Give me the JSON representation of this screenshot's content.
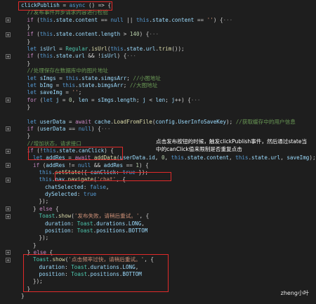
{
  "code_lines": [
    {
      "indent": 1,
      "fold": false,
      "tokens": [
        [
          "prop",
          "clickPublish"
        ],
        [
          "pl",
          " = "
        ],
        [
          "kw",
          "async"
        ],
        [
          "pl",
          " () => {"
        ]
      ]
    },
    {
      "indent": 2,
      "fold": false,
      "tokens": [
        [
          "cm",
          "//发布事件异步请求内容进行检验"
        ]
      ]
    },
    {
      "indent": 2,
      "fold": true,
      "tokens": [
        [
          "ctl",
          "if"
        ],
        [
          "pl",
          " ("
        ],
        [
          "kw",
          "this"
        ],
        [
          "pl",
          "."
        ],
        [
          "prop",
          "state"
        ],
        [
          "pl",
          "."
        ],
        [
          "prop",
          "content"
        ],
        [
          "pl",
          " == "
        ],
        [
          "kw",
          "null"
        ],
        [
          "pl",
          " || "
        ],
        [
          "kw",
          "this"
        ],
        [
          "pl",
          "."
        ],
        [
          "prop",
          "state"
        ],
        [
          "pl",
          "."
        ],
        [
          "prop",
          "content"
        ],
        [
          "pl",
          " == "
        ],
        [
          "str",
          "''"
        ],
        [
          "pl",
          ") {"
        ],
        [
          "ell",
          "···"
        ]
      ]
    },
    {
      "indent": 2,
      "fold": false,
      "tokens": [
        [
          "pl",
          "}"
        ]
      ]
    },
    {
      "indent": 2,
      "fold": true,
      "tokens": [
        [
          "ctl",
          "if"
        ],
        [
          "pl",
          " ("
        ],
        [
          "kw",
          "this"
        ],
        [
          "pl",
          "."
        ],
        [
          "prop",
          "state"
        ],
        [
          "pl",
          "."
        ],
        [
          "prop",
          "content"
        ],
        [
          "pl",
          "."
        ],
        [
          "prop",
          "length"
        ],
        [
          "pl",
          " > "
        ],
        [
          "num",
          "140"
        ],
        [
          "pl",
          ") {"
        ],
        [
          "ell",
          "···"
        ]
      ]
    },
    {
      "indent": 2,
      "fold": false,
      "tokens": [
        [
          "pl",
          "}"
        ]
      ]
    },
    {
      "indent": 2,
      "fold": false,
      "tokens": [
        [
          "kw",
          "let"
        ],
        [
          "pl",
          " "
        ],
        [
          "prop",
          "isUrl"
        ],
        [
          "pl",
          " = "
        ],
        [
          "cls",
          "Regular"
        ],
        [
          "pl",
          "."
        ],
        [
          "fn",
          "isUrl"
        ],
        [
          "pl",
          "("
        ],
        [
          "kw",
          "this"
        ],
        [
          "pl",
          "."
        ],
        [
          "prop",
          "state"
        ],
        [
          "pl",
          "."
        ],
        [
          "prop",
          "url"
        ],
        [
          "pl",
          "."
        ],
        [
          "fn",
          "trim"
        ],
        [
          "pl",
          "());"
        ]
      ]
    },
    {
      "indent": 2,
      "fold": true,
      "tokens": [
        [
          "ctl",
          "if"
        ],
        [
          "pl",
          " ("
        ],
        [
          "kw",
          "this"
        ],
        [
          "pl",
          "."
        ],
        [
          "prop",
          "state"
        ],
        [
          "pl",
          "."
        ],
        [
          "prop",
          "url"
        ],
        [
          "pl",
          " && !"
        ],
        [
          "prop",
          "isUrl"
        ],
        [
          "pl",
          ") {"
        ],
        [
          "ell",
          "···"
        ]
      ]
    },
    {
      "indent": 2,
      "fold": false,
      "tokens": [
        [
          "pl",
          "}"
        ]
      ]
    },
    {
      "indent": 2,
      "fold": false,
      "tokens": [
        [
          "cm",
          "//处理保存在数据库中的图片地址"
        ]
      ]
    },
    {
      "indent": 2,
      "fold": false,
      "tokens": [
        [
          "kw",
          "let"
        ],
        [
          "pl",
          " "
        ],
        [
          "prop",
          "sImgs"
        ],
        [
          "pl",
          " = "
        ],
        [
          "kw",
          "this"
        ],
        [
          "pl",
          "."
        ],
        [
          "prop",
          "state"
        ],
        [
          "pl",
          "."
        ],
        [
          "prop",
          "simgsArr"
        ],
        [
          "pl",
          "; "
        ],
        [
          "cm",
          "//小图地址"
        ]
      ]
    },
    {
      "indent": 2,
      "fold": false,
      "tokens": [
        [
          "kw",
          "let"
        ],
        [
          "pl",
          " "
        ],
        [
          "prop",
          "bImg"
        ],
        [
          "pl",
          " = "
        ],
        [
          "kw",
          "this"
        ],
        [
          "pl",
          "."
        ],
        [
          "prop",
          "state"
        ],
        [
          "pl",
          "."
        ],
        [
          "prop",
          "bimgsArr"
        ],
        [
          "pl",
          "; "
        ],
        [
          "cm",
          "//大图地址"
        ]
      ]
    },
    {
      "indent": 2,
      "fold": false,
      "tokens": [
        [
          "kw",
          "let"
        ],
        [
          "pl",
          " "
        ],
        [
          "prop",
          "saveImg"
        ],
        [
          "pl",
          " = "
        ],
        [
          "str",
          "''"
        ],
        [
          "pl",
          ";"
        ]
      ]
    },
    {
      "indent": 2,
      "fold": true,
      "tokens": [
        [
          "ctl",
          "for"
        ],
        [
          "pl",
          " ("
        ],
        [
          "kw",
          "let"
        ],
        [
          "pl",
          " "
        ],
        [
          "prop",
          "j"
        ],
        [
          "pl",
          " = "
        ],
        [
          "num",
          "0"
        ],
        [
          "pl",
          ", "
        ],
        [
          "prop",
          "len"
        ],
        [
          "pl",
          " = "
        ],
        [
          "prop",
          "sImgs"
        ],
        [
          "pl",
          "."
        ],
        [
          "prop",
          "length"
        ],
        [
          "pl",
          "; "
        ],
        [
          "prop",
          "j"
        ],
        [
          "pl",
          " < "
        ],
        [
          "prop",
          "len"
        ],
        [
          "pl",
          "; "
        ],
        [
          "prop",
          "j"
        ],
        [
          "pl",
          "++) {"
        ],
        [
          "ell",
          "···"
        ]
      ]
    },
    {
      "indent": 2,
      "fold": false,
      "tokens": [
        [
          "pl",
          "}"
        ]
      ]
    },
    {
      "indent": 2,
      "fold": false,
      "tokens": [
        [
          "pl",
          ""
        ]
      ]
    },
    {
      "indent": 2,
      "fold": false,
      "tokens": [
        [
          "kw",
          "let"
        ],
        [
          "pl",
          " "
        ],
        [
          "prop",
          "userData"
        ],
        [
          "pl",
          " = "
        ],
        [
          "ctl",
          "await"
        ],
        [
          "pl",
          " "
        ],
        [
          "prop",
          "cache"
        ],
        [
          "pl",
          "."
        ],
        [
          "fn",
          "LoadFromFile"
        ],
        [
          "pl",
          "("
        ],
        [
          "prop",
          "config"
        ],
        [
          "pl",
          "."
        ],
        [
          "prop",
          "UserInfoSaveKey"
        ],
        [
          "pl",
          "); "
        ],
        [
          "cm",
          "//获取缓存中的用户信息"
        ]
      ]
    },
    {
      "indent": 2,
      "fold": true,
      "tokens": [
        [
          "ctl",
          "if"
        ],
        [
          "pl",
          " ("
        ],
        [
          "prop",
          "userData"
        ],
        [
          "pl",
          " == "
        ],
        [
          "kw",
          "null"
        ],
        [
          "pl",
          ") {"
        ],
        [
          "ell",
          "···"
        ]
      ]
    },
    {
      "indent": 2,
      "fold": false,
      "tokens": [
        [
          "pl",
          "}"
        ]
      ]
    },
    {
      "indent": 2,
      "fold": false,
      "tokens": [
        [
          "cm",
          "//增加状态，请求接口"
        ]
      ]
    },
    {
      "indent": 2,
      "fold": true,
      "tokens": [
        [
          "ctl",
          "if"
        ],
        [
          "pl",
          " (!"
        ],
        [
          "kw",
          "this"
        ],
        [
          "pl",
          "."
        ],
        [
          "prop",
          "state"
        ],
        [
          "pl",
          "."
        ],
        [
          "prop",
          "canClick"
        ],
        [
          "pl",
          ") {"
        ]
      ]
    },
    {
      "indent": 3,
      "fold": false,
      "tokens": [
        [
          "kw",
          "let"
        ],
        [
          "pl",
          " "
        ],
        [
          "prop",
          "addRes"
        ],
        [
          "pl",
          " = "
        ],
        [
          "ctl",
          "await"
        ],
        [
          "pl",
          " "
        ],
        [
          "fn",
          "addData"
        ],
        [
          "pl",
          "("
        ],
        [
          "prop",
          "userData"
        ],
        [
          "pl",
          "."
        ],
        [
          "prop",
          "id"
        ],
        [
          "pl",
          ", "
        ],
        [
          "num",
          "0"
        ],
        [
          "pl",
          ", "
        ],
        [
          "kw",
          "this"
        ],
        [
          "pl",
          "."
        ],
        [
          "prop",
          "state"
        ],
        [
          "pl",
          "."
        ],
        [
          "prop",
          "content"
        ],
        [
          "pl",
          ", "
        ],
        [
          "kw",
          "this"
        ],
        [
          "pl",
          "."
        ],
        [
          "prop",
          "state"
        ],
        [
          "pl",
          "."
        ],
        [
          "prop",
          "url"
        ],
        [
          "pl",
          ", "
        ],
        [
          "prop",
          "saveImg"
        ],
        [
          "pl",
          ");"
        ]
      ]
    },
    {
      "indent": 3,
      "fold": true,
      "tokens": [
        [
          "ctl",
          "if"
        ],
        [
          "pl",
          " ("
        ],
        [
          "prop",
          "addRes"
        ],
        [
          "pl",
          " != "
        ],
        [
          "kw",
          "null"
        ],
        [
          "pl",
          " && "
        ],
        [
          "prop",
          "addRes"
        ],
        [
          "pl",
          " == "
        ],
        [
          "num",
          "1"
        ],
        [
          "pl",
          ") {"
        ]
      ]
    },
    {
      "indent": 4,
      "fold": false,
      "tokens": [
        [
          "kw",
          "this"
        ],
        [
          "pl",
          "."
        ],
        [
          "fn",
          "setState"
        ],
        [
          "pl",
          "({ "
        ],
        [
          "prop",
          "canClick"
        ],
        [
          "pl",
          ": "
        ],
        [
          "kw",
          "true"
        ],
        [
          "pl",
          " });"
        ]
      ]
    },
    {
      "indent": 4,
      "fold": true,
      "tokens": [
        [
          "kw",
          "this"
        ],
        [
          "pl",
          "."
        ],
        [
          "prop",
          "nav"
        ],
        [
          "pl",
          "."
        ],
        [
          "fn",
          "navigate"
        ],
        [
          "pl",
          "("
        ],
        [
          "str",
          "'chat'"
        ],
        [
          "pl",
          ", {"
        ]
      ]
    },
    {
      "indent": 5,
      "fold": false,
      "tokens": [
        [
          "prop",
          "chatSelected"
        ],
        [
          "pl",
          ": "
        ],
        [
          "kw",
          "false"
        ],
        [
          "pl",
          ","
        ]
      ]
    },
    {
      "indent": 5,
      "fold": false,
      "tokens": [
        [
          "prop",
          "dySelected"
        ],
        [
          "pl",
          ": "
        ],
        [
          "kw",
          "true"
        ]
      ]
    },
    {
      "indent": 4,
      "fold": false,
      "tokens": [
        [
          "pl",
          "});"
        ]
      ]
    },
    {
      "indent": 3,
      "fold": true,
      "tokens": [
        [
          "pl",
          "} "
        ],
        [
          "ctl",
          "else"
        ],
        [
          "pl",
          " {"
        ]
      ]
    },
    {
      "indent": 4,
      "fold": true,
      "tokens": [
        [
          "cls",
          "Toast"
        ],
        [
          "pl",
          "."
        ],
        [
          "fn",
          "show"
        ],
        [
          "pl",
          "("
        ],
        [
          "str",
          "'发布失败，请稍后重试。'"
        ],
        [
          "pl",
          ", {"
        ]
      ]
    },
    {
      "indent": 5,
      "fold": false,
      "tokens": [
        [
          "prop",
          "duration"
        ],
        [
          "pl",
          ": "
        ],
        [
          "cls",
          "Toast"
        ],
        [
          "pl",
          "."
        ],
        [
          "prop",
          "durations"
        ],
        [
          "pl",
          "."
        ],
        [
          "prop",
          "LONG"
        ],
        [
          "pl",
          ","
        ]
      ]
    },
    {
      "indent": 5,
      "fold": false,
      "tokens": [
        [
          "prop",
          "position"
        ],
        [
          "pl",
          ": "
        ],
        [
          "cls",
          "Toast"
        ],
        [
          "pl",
          "."
        ],
        [
          "prop",
          "positions"
        ],
        [
          "pl",
          "."
        ],
        [
          "prop",
          "BOTTOM"
        ]
      ]
    },
    {
      "indent": 4,
      "fold": false,
      "tokens": [
        [
          "pl",
          "});"
        ]
      ]
    },
    {
      "indent": 3,
      "fold": false,
      "tokens": [
        [
          "pl",
          "}"
        ]
      ]
    },
    {
      "indent": 2,
      "fold": true,
      "tokens": [
        [
          "pl",
          "} "
        ],
        [
          "ctl",
          "else"
        ],
        [
          "pl",
          " {"
        ]
      ]
    },
    {
      "indent": 3,
      "fold": true,
      "tokens": [
        [
          "cls",
          "Toast"
        ],
        [
          "pl",
          "."
        ],
        [
          "fn",
          "show"
        ],
        [
          "pl",
          "("
        ],
        [
          "str",
          "'点击频率过快，请稍后重试。'"
        ],
        [
          "pl",
          ", {"
        ]
      ]
    },
    {
      "indent": 4,
      "fold": false,
      "tokens": [
        [
          "prop",
          "duration"
        ],
        [
          "pl",
          ": "
        ],
        [
          "cls",
          "Toast"
        ],
        [
          "pl",
          "."
        ],
        [
          "prop",
          "durations"
        ],
        [
          "pl",
          "."
        ],
        [
          "prop",
          "LONG"
        ],
        [
          "pl",
          ","
        ]
      ]
    },
    {
      "indent": 4,
      "fold": false,
      "tokens": [
        [
          "prop",
          "position"
        ],
        [
          "pl",
          ": "
        ],
        [
          "cls",
          "Toast"
        ],
        [
          "pl",
          "."
        ],
        [
          "prop",
          "positions"
        ],
        [
          "pl",
          "."
        ],
        [
          "prop",
          "BOTTOM"
        ]
      ]
    },
    {
      "indent": 3,
      "fold": false,
      "tokens": [
        [
          "pl",
          "});"
        ]
      ]
    },
    {
      "indent": 2,
      "fold": false,
      "tokens": [
        [
          "pl",
          "}"
        ]
      ]
    },
    {
      "indent": 1,
      "fold": false,
      "tokens": [
        [
          "pl",
          "}"
        ]
      ]
    }
  ],
  "annotation": {
    "note": "点击发布按钮的时候，触发clickPublish事件，然后通过state当中的canClick值来限制是否重复点击"
  },
  "watermark": "zheng小叶",
  "colors": {
    "background": "#1e1e1e",
    "highlight_box": "#e02a2a",
    "keyword": "#569cd6",
    "control": "#c586c0",
    "function": "#dcdcaa",
    "string": "#ce9178",
    "comment": "#6a9955",
    "property": "#9cdcfe"
  }
}
